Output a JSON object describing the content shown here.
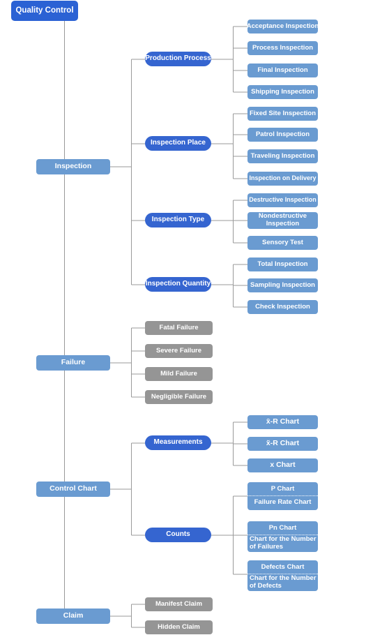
{
  "diagram": {
    "title": "Quality Control",
    "type": "tree-mindmap",
    "colors": {
      "root": "#2b62d4",
      "level2": "#6a9bd1",
      "level3": "#3565d0",
      "leaf_blue": "#6a9bd1",
      "leaf_gray": "#959595",
      "connector": "#999999",
      "background": "#ffffff",
      "text": "#ffffff"
    }
  },
  "root": {
    "label": "Quality Control"
  },
  "branches": [
    {
      "label": "Inspection",
      "groups": [
        {
          "label": "Production Process",
          "items": [
            {
              "label": "Acceptance Inspection"
            },
            {
              "label": "Process Inspection"
            },
            {
              "label": "Final Inspection"
            },
            {
              "label": "Shipping Inspection"
            }
          ]
        },
        {
          "label": "Inspection Place",
          "items": [
            {
              "label": "Fixed Site Inspection"
            },
            {
              "label": "Patrol Inspection"
            },
            {
              "label": "Traveling Inspection"
            },
            {
              "label": "Inspection on Delivery"
            }
          ]
        },
        {
          "label": "Inspection Type",
          "items": [
            {
              "label": "Destructive Inspection"
            },
            {
              "label": "Nondestructive Inspection"
            },
            {
              "label": "Sensory Test"
            }
          ]
        },
        {
          "label": "Inspection Quantity",
          "items": [
            {
              "label": "Total Inspection"
            },
            {
              "label": "Sampling Inspection"
            },
            {
              "label": "Check Inspection"
            }
          ]
        }
      ]
    },
    {
      "label": "Failure",
      "items": [
        {
          "label": "Fatal Failure"
        },
        {
          "label": "Severe Failure"
        },
        {
          "label": "Mild Failure"
        },
        {
          "label": "Negligible Failure"
        }
      ]
    },
    {
      "label": "Control Chart",
      "groups": [
        {
          "label": "Measurements",
          "items": [
            {
              "label": "x̄-R Chart"
            },
            {
              "label": "x̃-R Chart"
            },
            {
              "label": "x Chart"
            }
          ]
        },
        {
          "label": "Counts",
          "items": [
            {
              "title": "P Chart",
              "subtitle": "Failure Rate Chart"
            },
            {
              "title": "Pn Chart",
              "subtitle": "Chart for the Number of Failures"
            },
            {
              "title": "Defects Chart",
              "subtitle": "Chart for the Number of Defects"
            }
          ]
        }
      ]
    },
    {
      "label": "Claim",
      "items": [
        {
          "label": "Manifest Claim"
        },
        {
          "label": "Hidden Claim"
        }
      ]
    }
  ]
}
